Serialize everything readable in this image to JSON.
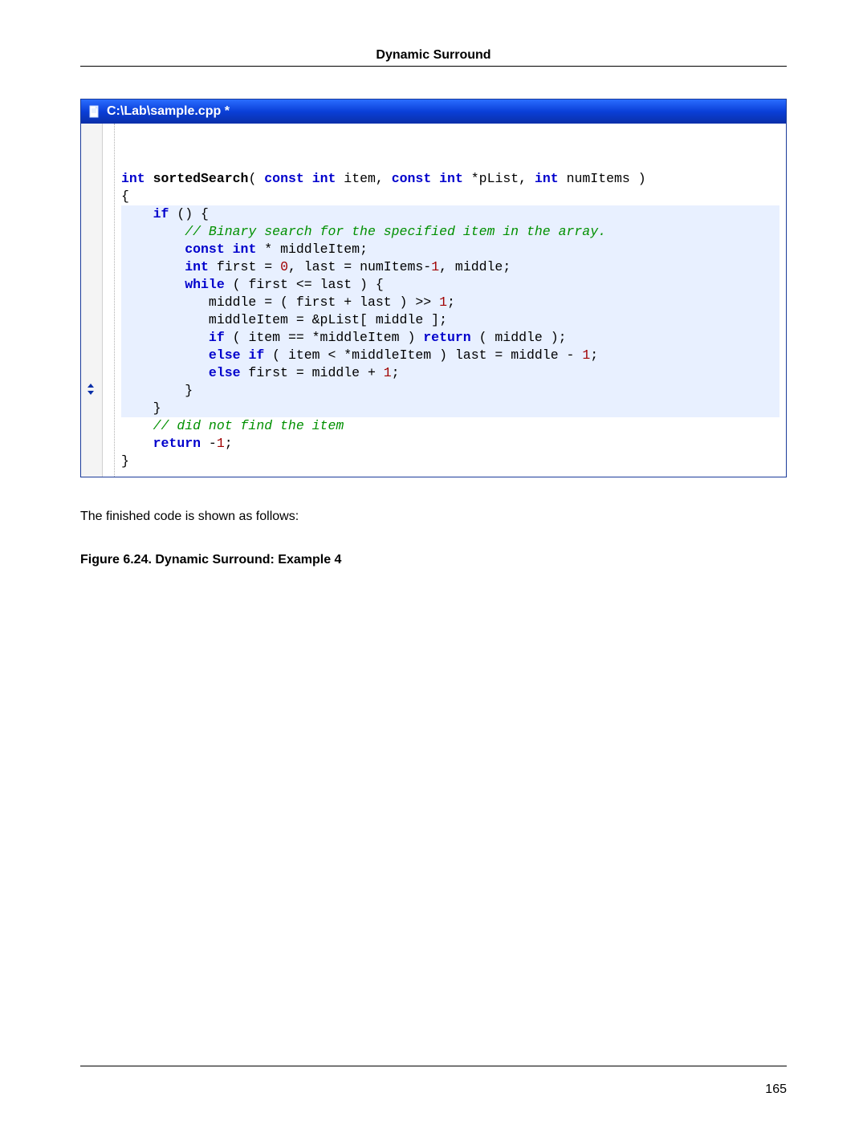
{
  "header": {
    "title": "Dynamic Surround"
  },
  "footer": {
    "page_number": "165"
  },
  "window": {
    "title": "C:\\Lab\\sample.cpp *"
  },
  "body": {
    "text_after": "The finished code is shown as follows:",
    "figure_caption": "Figure 6.24. Dynamic Surround: Example 4"
  },
  "code": {
    "sig_kw_int": "int",
    "sig_fn": "sortedSearch",
    "sig_open": "( ",
    "sig_kw_const1": "const",
    "sig_kw_int2": "int",
    "sig_item": " item, ",
    "sig_kw_const2": "const",
    "sig_kw_int3": "int",
    "sig_plist": " *pList, ",
    "sig_kw_int4": "int",
    "sig_numitems": " numItems )",
    "open_brace": "{",
    "if_kw": "if",
    "if_rest": " () {",
    "comment1": "// Binary search for the specified item in the array.",
    "decl_const": "const",
    "decl_int": "int",
    "decl_mid": " * middleItem;",
    "decl2_int": "int",
    "decl2_a": " first = ",
    "decl2_zero": "0",
    "decl2_b": ", last = numItems-",
    "decl2_one": "1",
    "decl2_c": ", middle;",
    "while_kw": "while",
    "while_rest": " ( first <= last ) {",
    "shift_a": "middle = ( first + last ) >> ",
    "shift_one": "1",
    "shift_b": ";",
    "mid_assign": "middleItem = &pList[ middle ];",
    "if2_kw": "if",
    "if2_a": " ( item == *middleItem ) ",
    "return_kw": "return",
    "if2_b": " ( middle );",
    "else_kw": "else",
    "if3_kw": "if",
    "elseif_a": " ( item < *middleItem ) last = middle - ",
    "elseif_one": "1",
    "elseif_b": ";",
    "else2_kw": "else",
    "else_a": " first = middle + ",
    "else_one": "1",
    "else_b": ";",
    "close_while": "}",
    "close_if": "}",
    "comment2": "// did not find the item",
    "return2_kw": "return",
    "return2_a": " -",
    "return2_one": "1",
    "return2_b": ";",
    "close_fn": "}"
  }
}
